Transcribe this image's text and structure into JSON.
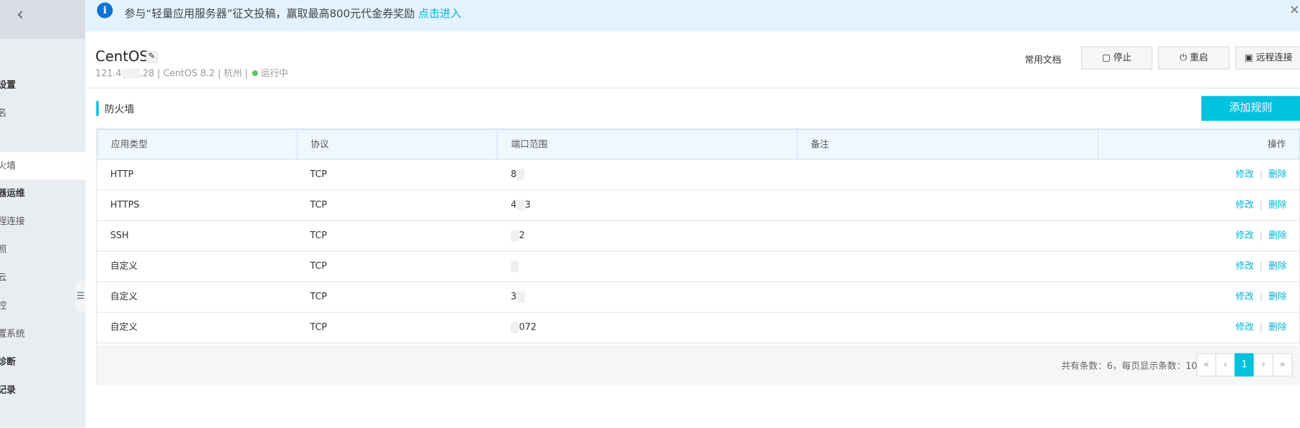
{
  "sidebar": {
    "back_icon": "chevron-left-icon",
    "items": [
      {
        "label": "设置",
        "bold": true
      },
      {
        "label": "名"
      },
      {
        "label": "火墙",
        "active": true
      },
      {
        "label": "器运维",
        "bold": true
      },
      {
        "label": "程连接"
      },
      {
        "label": "照"
      },
      {
        "label": "云"
      },
      {
        "label": "控"
      },
      {
        "label": "置系统"
      },
      {
        "label": "诊断",
        "bold": true
      },
      {
        "label": "记录",
        "bold": true
      }
    ],
    "collapse_icon": "collapse-menu-icon"
  },
  "banner": {
    "text": "参与“轻量应用服务器”征文投稿，赢取最高800元代金券奖励",
    "link": "点击进入",
    "info_icon": "i",
    "close": "✕"
  },
  "header": {
    "title": "CentOS",
    "ip_prefix": "121.4",
    "ip_suffix": ".28",
    "os": "CentOS 8.2",
    "region": "杭州",
    "status": "运行中",
    "status_color": "#5fc45f",
    "docs": "常用文档",
    "buttons": {
      "stop": "停止",
      "restart": "重启",
      "remote": "远程连接"
    }
  },
  "firewall": {
    "title": "防火墙",
    "add_rule": "添加规则",
    "columns": [
      "应用类型",
      "协议",
      "端口范围",
      "备注",
      "操作"
    ],
    "rows": [
      {
        "type": "HTTP",
        "protocol": "TCP",
        "port_pre": "8",
        "port_post": "",
        "note": ""
      },
      {
        "type": "HTTPS",
        "protocol": "TCP",
        "port_pre": "4",
        "port_post": "3",
        "note": ""
      },
      {
        "type": "SSH",
        "protocol": "TCP",
        "port_pre": "",
        "port_post": "2",
        "note": ""
      },
      {
        "type": "自定义",
        "protocol": "TCP",
        "port_pre": "",
        "port_post": "",
        "note": ""
      },
      {
        "type": "自定义",
        "protocol": "TCP",
        "port_pre": "3",
        "port_post": "",
        "note": ""
      },
      {
        "type": "自定义",
        "protocol": "TCP",
        "port_pre": "",
        "port_post": "072",
        "note": ""
      }
    ],
    "actions": {
      "edit": "修改",
      "delete": "删除"
    },
    "footer": {
      "total": "共有条数：6，每页显示条数：10",
      "pages": [
        "«",
        "‹",
        "1",
        "›",
        "»"
      ],
      "current": "1"
    }
  },
  "accent": "#00c1de"
}
